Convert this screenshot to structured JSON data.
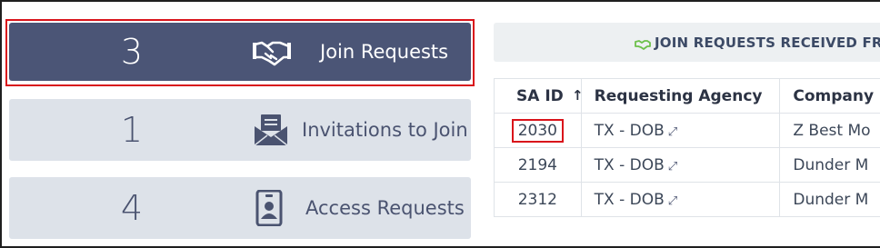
{
  "tiles": [
    {
      "count": "3",
      "label": "Join Requests",
      "icon": "handshake-icon",
      "active": true
    },
    {
      "count": "1",
      "label": "Invitations to Join",
      "icon": "envelope-letter-icon",
      "active": false
    },
    {
      "count": "4",
      "label": "Access Requests",
      "icon": "id-badge-icon",
      "active": false
    }
  ],
  "banner": {
    "icon": "handshake-icon",
    "icon_color": "#6cc04a",
    "text": "JOIN REQUESTS RECEIVED FRO"
  },
  "table": {
    "headers": [
      "SA ID",
      "Requesting Agency",
      "Company"
    ],
    "sort_indicator": "↑",
    "rows": [
      {
        "sa_id": "2030",
        "agency": "TX - DOB",
        "company": "Z Best Mo",
        "highlighted": true
      },
      {
        "sa_id": "2194",
        "agency": "TX - DOB",
        "company": "Dunder M"
      },
      {
        "sa_id": "2312",
        "agency": "TX - DOB",
        "company": "Dunder M"
      }
    ],
    "external_link_glyph": "⤢"
  },
  "colors": {
    "active_tile": "#4b5576",
    "inactive_tile": "#dde2e9",
    "highlight": "#d9141b"
  }
}
